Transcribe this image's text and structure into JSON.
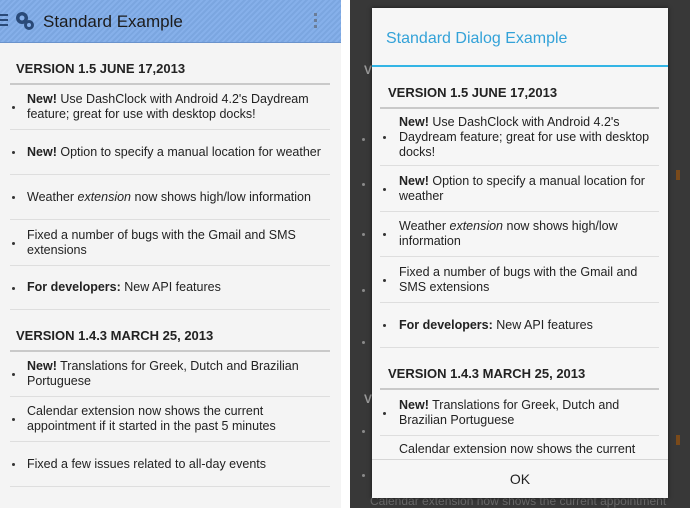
{
  "left": {
    "title": "Standard Example",
    "sections": [
      {
        "header": "VERSION 1.5   JUNE 17,2013",
        "items": [
          {
            "bold": "New!",
            "text": " Use DashClock with Android 4.2's Daydream feature; great for use with desktop docks!"
          },
          {
            "bold": "New!",
            "text": " Option to specify a manual location for weather"
          },
          {
            "pre": "Weather ",
            "italic": "extension",
            "text": " now shows high/low information"
          },
          {
            "text": "Fixed a number of bugs with the Gmail and SMS extensions"
          },
          {
            "bold": "For developers:",
            "text": " New API features"
          }
        ]
      },
      {
        "header": "VERSION 1.4.3   MARCH 25, 2013",
        "items": [
          {
            "bold": "New!",
            "text": " Translations for Greek, Dutch and Brazilian Portuguese"
          },
          {
            "text": "Calendar extension now shows the current appointment if it started in the past 5 minutes"
          },
          {
            "text": "Fixed a few issues related to all-day events"
          }
        ]
      }
    ]
  },
  "right": {
    "dialog_title": "Standard Dialog Example",
    "ok_label": "OK",
    "background_bottom_text": "Calendar extension now shows the current appointment",
    "sections": [
      {
        "header": "VERSION 1.5   JUNE 17,2013",
        "items": [
          {
            "bold": "New!",
            "text": " Use DashClock with Android 4.2's Daydream feature; great for use with desktop docks!"
          },
          {
            "bold": "New!",
            "text": " Option to specify a manual location for weather"
          },
          {
            "pre": "Weather ",
            "italic": "extension",
            "text": " now shows high/low information"
          },
          {
            "text": "Fixed a number of bugs with the Gmail and SMS extensions"
          },
          {
            "bold": "For developers:",
            "text": " New API features"
          }
        ]
      },
      {
        "header": "VERSION 1.4.3   MARCH 25, 2013",
        "items": [
          {
            "bold": "New!",
            "text": " Translations for Greek, Dutch and Brazilian Portuguese"
          },
          {
            "text": "Calendar extension now shows the current"
          }
        ]
      }
    ]
  },
  "colors": {
    "action_bar": "#86b0ea",
    "dialog_accent": "#33b5e5",
    "dim_background": "#383838"
  },
  "icons": [
    "menu-icon",
    "app-logo-icon",
    "overflow-menu-icon"
  ]
}
